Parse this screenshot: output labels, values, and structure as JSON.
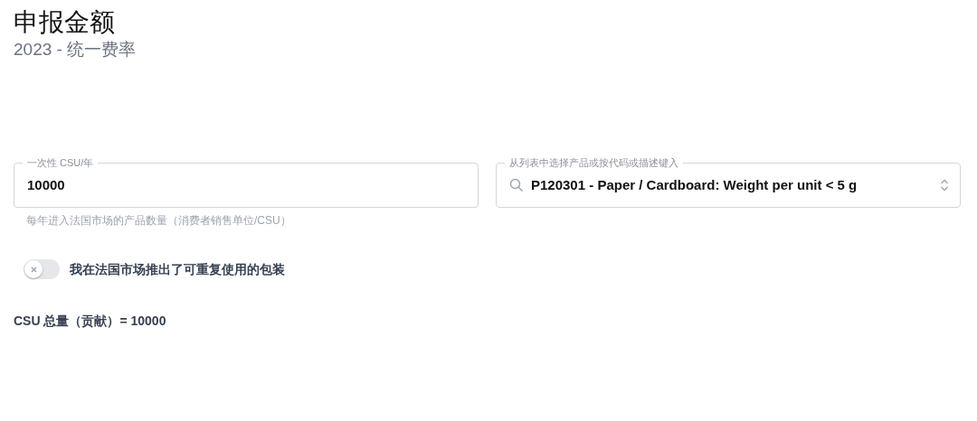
{
  "header": {
    "title": "申报金额",
    "subtitle": "2023  - 统一费率"
  },
  "quantity_field": {
    "label": "一次性 CSU/年",
    "value": "10000",
    "help": "每年进入法国市场的产品数量（消费者销售单位/CSU）"
  },
  "product_field": {
    "label": "从列表中选择产品或按代码或描述键入",
    "value": "P120301 - Paper / Cardboard: Weight per unit < 5 g"
  },
  "reusable_toggle": {
    "label": "我在法国市场推出了可重复使用的包装",
    "on": false
  },
  "total": "CSU 总量（贡献）= 10000"
}
